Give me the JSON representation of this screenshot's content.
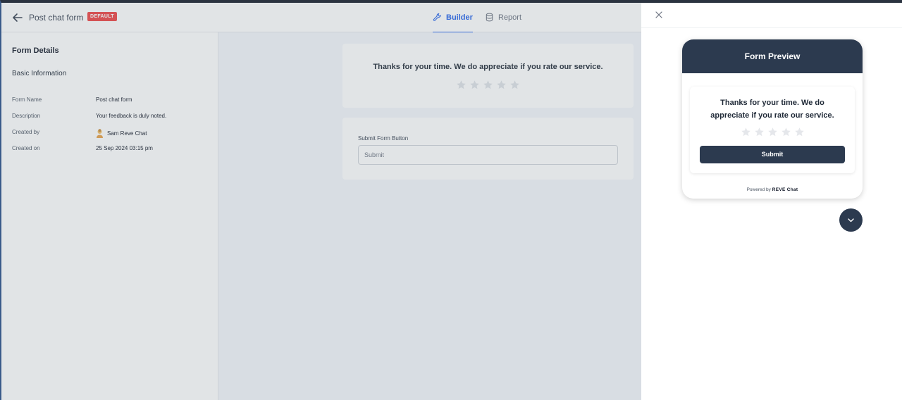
{
  "topbar": {
    "form_title": "Post chat form",
    "badge": "DEFAULT",
    "tabs": [
      {
        "label": "Builder",
        "active": true,
        "icon": "wrench-icon"
      },
      {
        "label": "Report",
        "active": false,
        "icon": "database-icon"
      }
    ]
  },
  "details": {
    "title": "Form Details",
    "subtitle": "Basic Information",
    "rows": [
      {
        "key": "Form Name",
        "value": "Post chat form"
      },
      {
        "key": "Description",
        "value": "Your feedback is duly noted."
      },
      {
        "key": "Created by",
        "value": "Sam Reve Chat"
      },
      {
        "key": "Created on",
        "value": "25 Sep 2024 03:15 pm"
      }
    ]
  },
  "builder": {
    "question": "Thanks for your time. We do appreciate if you rate our service.",
    "rating_max": 5,
    "submit_field_label": "Submit Form Button",
    "submit_field_value": "Submit"
  },
  "preview": {
    "header": "Form Preview",
    "question_line1": "Thanks for your time. We do",
    "question_line2": "appreciate if you rate our service.",
    "submit_label": "Submit",
    "powered_by": "Powered by",
    "brand": "REVE Chat"
  },
  "colors": {
    "primary_dark": "#2c3a4f",
    "accent": "#2563eb",
    "badge": "#ef4444"
  }
}
